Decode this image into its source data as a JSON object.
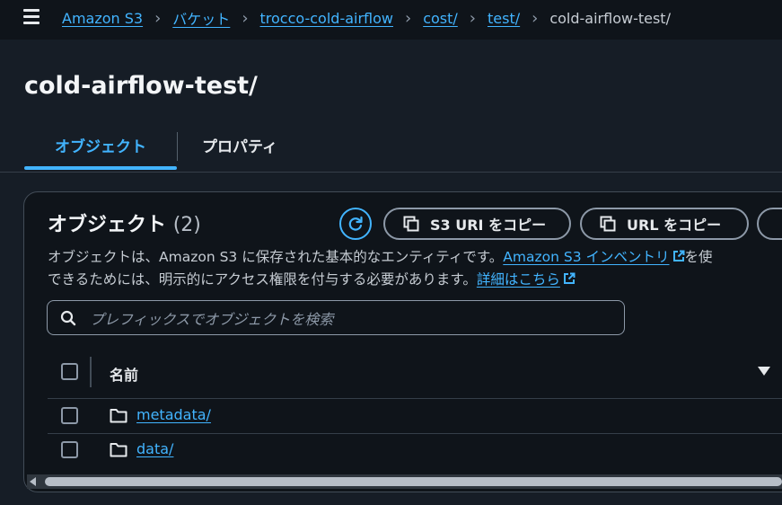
{
  "breadcrumb": {
    "items": [
      "Amazon S3",
      "バケット",
      "trocco-cold-airflow",
      "cost/",
      "test/"
    ],
    "current": "cold-airflow-test/"
  },
  "page": {
    "title": "cold-airflow-test/"
  },
  "tabs": [
    {
      "label": "オブジェクト",
      "active": true
    },
    {
      "label": "プロパティ",
      "active": false
    }
  ],
  "objects_panel": {
    "title": "オブジェクト",
    "count": "(2)",
    "copy_s3_uri_label": "S3 URI をコピー",
    "copy_url_label": "URL をコピー",
    "description_line1_prefix": "オブジェクトは、Amazon S3 に保存された基本的なエンティティです。",
    "inventory_link": "Amazon S3 インベントリ",
    "description_line1_suffix": "を使",
    "description_line2_prefix": "できるためには、明示的にアクセス権限を付与する必要があります。",
    "learn_more_link": "詳細はこちら",
    "search_placeholder": "プレフィックスでオブジェクトを検索",
    "search_value": "",
    "column_name": "名前",
    "rows": [
      {
        "name": "metadata/"
      },
      {
        "name": "data/"
      }
    ]
  },
  "colors": {
    "background": "#161d26",
    "accent": "#42b4ff",
    "panel": "#0f141a"
  },
  "icons": [
    "menu-icon",
    "refresh-icon",
    "copy-icon",
    "external-link-icon",
    "search-icon",
    "folder-icon",
    "sort-down-icon"
  ]
}
